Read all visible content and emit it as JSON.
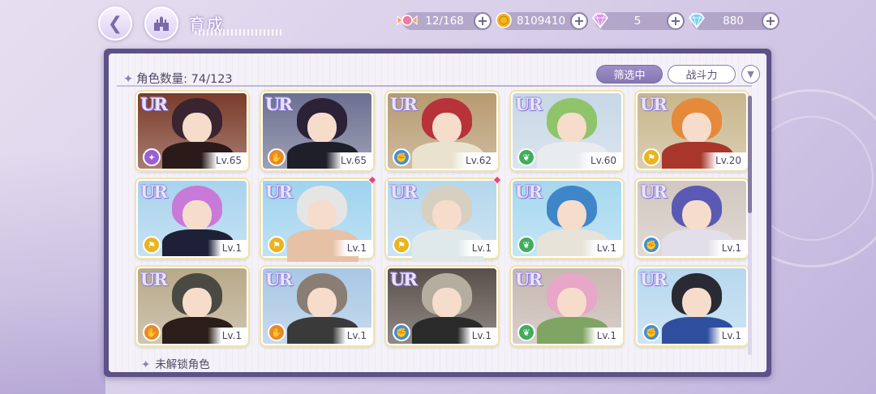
{
  "header": {
    "title": "育成",
    "back_icon": "back-arrow-icon",
    "home_icon": "castle-home-icon"
  },
  "resources": [
    {
      "name": "stamina",
      "icon": "candy-icon",
      "value": "12/168"
    },
    {
      "name": "gold",
      "icon": "coin-icon",
      "value": "8109410"
    },
    {
      "name": "pink_gem",
      "icon": "pink-diamond-icon",
      "value": "5"
    },
    {
      "name": "blue_gem",
      "icon": "blue-diamond-icon",
      "value": "880"
    }
  ],
  "panel": {
    "count_label": "角色数量: 74/123",
    "filter_label": "筛选中",
    "sort_label": "战斗力",
    "sort_toggle_icon": "chevron-down-icon",
    "locked_label": "未解锁角色"
  },
  "characters": [
    {
      "rarity": "UR",
      "level": "Lv.65",
      "class": "purple",
      "hair": "#3a2430",
      "bg": "#7a3b2a",
      "outfit": "#2a1a1a"
    },
    {
      "rarity": "UR",
      "level": "Lv.65",
      "class": "orange",
      "hair": "#2b2238",
      "bg": "#6c7090",
      "outfit": "#1f1f2a"
    },
    {
      "rarity": "UR",
      "level": "Lv.62",
      "class": "blue",
      "hair": "#b8323a",
      "bg": "#b79a70",
      "outfit": "#e9e2cf"
    },
    {
      "rarity": "UR",
      "level": "Lv.60",
      "class": "green",
      "hair": "#8fc46a",
      "bg": "#c7d7e6",
      "outfit": "#e8ecef"
    },
    {
      "rarity": "UR",
      "level": "Lv.20",
      "class": "yellow",
      "hair": "#e58a3b",
      "bg": "#c8b68c",
      "outfit": "#a8362b"
    },
    {
      "rarity": "UR",
      "level": "Lv.1",
      "class": "yellow",
      "hair": "#c97ad8",
      "bg": "#a9d3ee",
      "outfit": "#1d2037"
    },
    {
      "rarity": "UR",
      "level": "Lv.1",
      "class": "yellow",
      "hair": "#e5e5e5",
      "bg": "#9fd3ef",
      "outfit": "#e6c1a6"
    },
    {
      "rarity": "UR",
      "level": "Lv.1",
      "class": "yellow",
      "hair": "#d7cfc0",
      "bg": "#b4d7ec",
      "outfit": "#dfe9ea"
    },
    {
      "rarity": "UR",
      "level": "Lv.1",
      "class": "green",
      "hair": "#3f86c8",
      "bg": "#a6d8ef",
      "outfit": "#e8e3d8"
    },
    {
      "rarity": "UR",
      "level": "Lv.1",
      "class": "blue",
      "hair": "#5a5ab5",
      "bg": "#d2c7c0",
      "outfit": "#e3dfea"
    },
    {
      "rarity": "UR",
      "level": "Lv.1",
      "class": "orange",
      "hair": "#4a4a42",
      "bg": "#b8a98a",
      "outfit": "#2b1d1a"
    },
    {
      "rarity": "UR",
      "level": "Lv.1",
      "class": "orange",
      "hair": "#8a7e74",
      "bg": "#a9c7e4",
      "outfit": "#3a3a3a"
    },
    {
      "rarity": "UR",
      "level": "Lv.1",
      "class": "blue",
      "hair": "#b5aea0",
      "bg": "#5a4f4a",
      "outfit": "#2a2a2a"
    },
    {
      "rarity": "UR",
      "level": "Lv.1",
      "class": "green",
      "hair": "#e8a6c8",
      "bg": "#c6b7b0",
      "outfit": "#7fa463"
    },
    {
      "rarity": "UR",
      "level": "Lv.1",
      "class": "blue",
      "hair": "#2a2a34",
      "bg": "#b7d8ee",
      "outfit": "#2f4f9e"
    }
  ],
  "colors": {
    "panel_frame": "#5c5287",
    "filter_active": "#8e80bb",
    "class_purple": "#9a5fd0",
    "class_orange": "#e8892a",
    "class_blue": "#3f8fd8",
    "class_green": "#3fae5a",
    "class_yellow": "#e9b41f",
    "new_marker": "#e8457d"
  }
}
